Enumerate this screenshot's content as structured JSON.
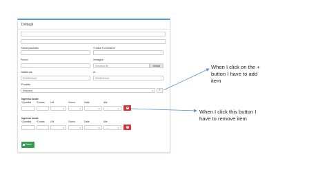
{
  "panel": {
    "title": "Dettagli"
  },
  "form": {
    "field_top1": "...",
    "field_top2": "...",
    "nome_label": "*Nome pacchetto",
    "nome_value": "...",
    "codice_label": "*Codice E-commerce",
    "codice_value": "...",
    "prezzo_label": "Prezzo",
    "prezzo_value": "...",
    "immagine_label": "Immagine",
    "immagine_placeholder": "Seleziona file",
    "browse_label": "Browse",
    "validita_label": "Validità dal",
    "validita_placeholder": "DD/MM/AAAA",
    "al_label": "Al",
    "al_placeholder": "DD/MM/AAAA",
    "prodotto_label": "*Prodotto",
    "prodotto_value": "Seleziona",
    "plus_label": "+"
  },
  "ingresso": [
    {
      "title": "Ingresso locale",
      "headers": [
        "*Quantità",
        "*Durata",
        "UM",
        "Giorno",
        "Dalle",
        "Alle"
      ],
      "values": [
        "...",
        "...",
        "...",
        "...",
        "--:--",
        "--:--"
      ]
    },
    {
      "title": "Ingresso locale",
      "headers": [
        "*Quantità",
        "*Durata",
        "UM",
        "Giorno",
        "Dalle",
        "Alle"
      ],
      "values": [
        "...",
        "...",
        "...",
        "...",
        "--:--",
        "--:--"
      ]
    }
  ],
  "save_label": "Salva",
  "annotations": {
    "add_note": "When I click on the + button I have to add item",
    "add_lines": [
      "When I click on the +",
      "button I have to add",
      "item"
    ],
    "remove_note": "When I click this button I have to remove item",
    "remove_lines": [
      "When I click this button I",
      "have to remove item"
    ]
  },
  "colors": {
    "accent": "#4a9cd1",
    "delete": "#d9343a",
    "save": "#2e9f4f",
    "arrow": "#5b8fd6"
  },
  "icons": {
    "delete": "delete-circle-icon",
    "save": "floppy-icon",
    "clock": "clock-icon",
    "caret": "chevron-down-icon"
  }
}
